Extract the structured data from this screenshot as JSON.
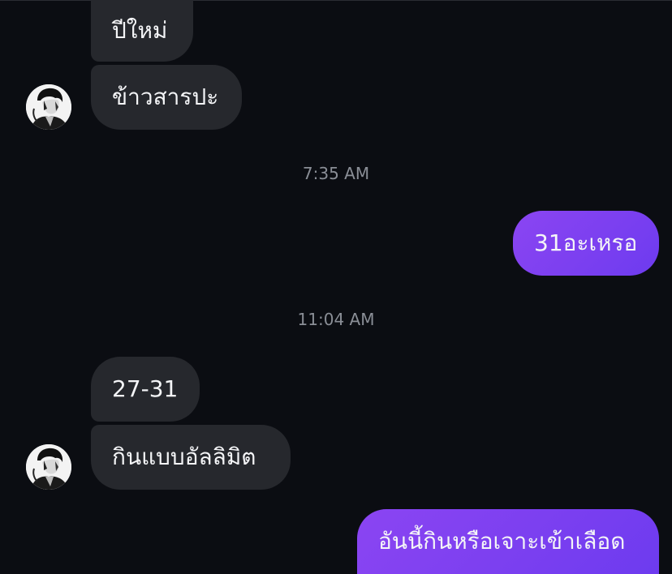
{
  "messages": [
    {
      "id": "m1",
      "side": "in",
      "text": "ปีใหม่"
    },
    {
      "id": "m2",
      "side": "in",
      "text": "ข้าวสารปะ"
    },
    {
      "id": "t1",
      "type": "time",
      "text": "7:35 AM"
    },
    {
      "id": "m3",
      "side": "out",
      "text": "31อะเหรอ"
    },
    {
      "id": "t2",
      "type": "time",
      "text": "11:04 AM"
    },
    {
      "id": "m4",
      "side": "in",
      "text": "27-31"
    },
    {
      "id": "m5",
      "side": "in",
      "text": "กินแบบอัลลิมิต"
    },
    {
      "id": "m6",
      "side": "out",
      "text": "อันนี้กินหรือเจาะเข้าเลือด"
    }
  ],
  "colors": {
    "background": "#0b0d12",
    "incoming_bubble": "#26282d",
    "outgoing_bubble": "#7a3ff0",
    "timestamp": "#8a8e96"
  },
  "icons": [
    "avatar"
  ]
}
